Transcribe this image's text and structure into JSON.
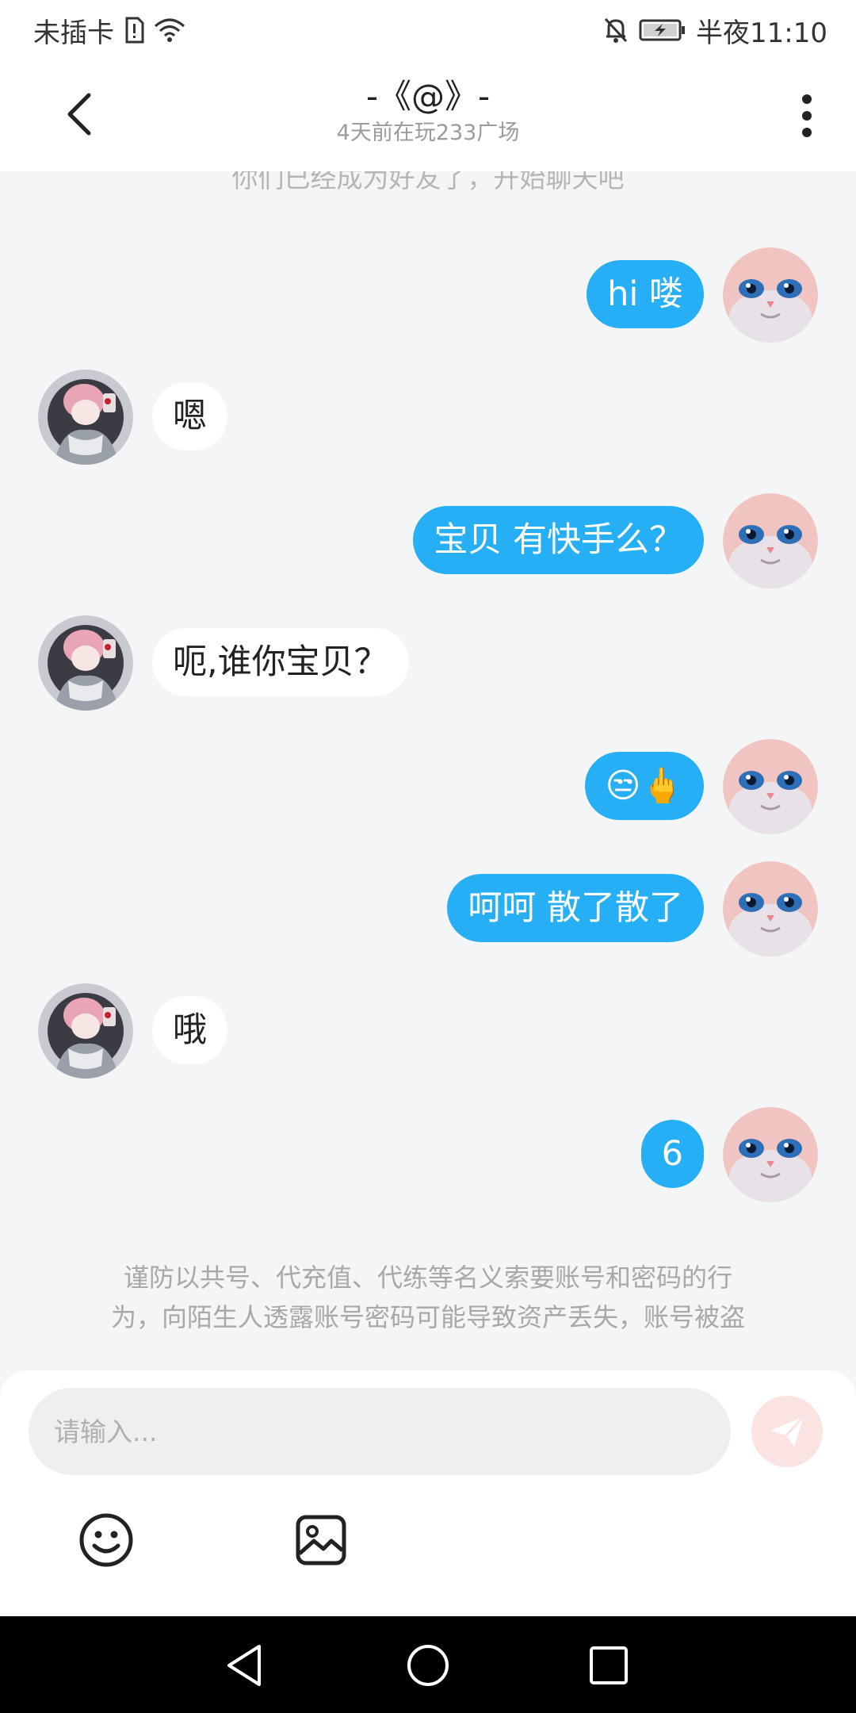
{
  "status_bar": {
    "carrier": "未插卡",
    "time": "半夜11:10",
    "icons": [
      "sim-alert-icon",
      "wifi-icon",
      "mute-bell-icon",
      "battery-charging-icon"
    ]
  },
  "header": {
    "title": "-《@》-",
    "subtitle": "4天前在玩233广场",
    "back_icon": "back-arrow-icon",
    "more_icon": "more-vertical-icon"
  },
  "chat": {
    "system_note": "你们已经成为好友了，开始聊天吧",
    "messages": [
      {
        "sender": "me",
        "text": "hi  喽"
      },
      {
        "sender": "friend",
        "text": "嗯"
      },
      {
        "sender": "me",
        "text": "宝贝  有快手么？"
      },
      {
        "sender": "friend",
        "text": "呃,谁你宝贝？"
      },
      {
        "sender": "me",
        "text": "😒🖕"
      },
      {
        "sender": "me",
        "text": "呵呵  散了散了"
      },
      {
        "sender": "friend",
        "text": "哦"
      },
      {
        "sender": "me",
        "text": "6"
      }
    ],
    "warning_line1": "谨防以共号、代充值、代练等名义索要账号和密码的行",
    "warning_line2": "为，向陌生人透露账号密码可能导致资产丢失，账号被盗"
  },
  "input": {
    "placeholder": "请输入...",
    "send_icon": "send-icon",
    "emoji_icon": "emoji-icon",
    "image_icon": "image-icon"
  },
  "colors": {
    "bubble_out": "#27aff5",
    "bubble_in": "#ffffff",
    "background": "#f4f5f7",
    "send_button": "#fbe3e1"
  }
}
